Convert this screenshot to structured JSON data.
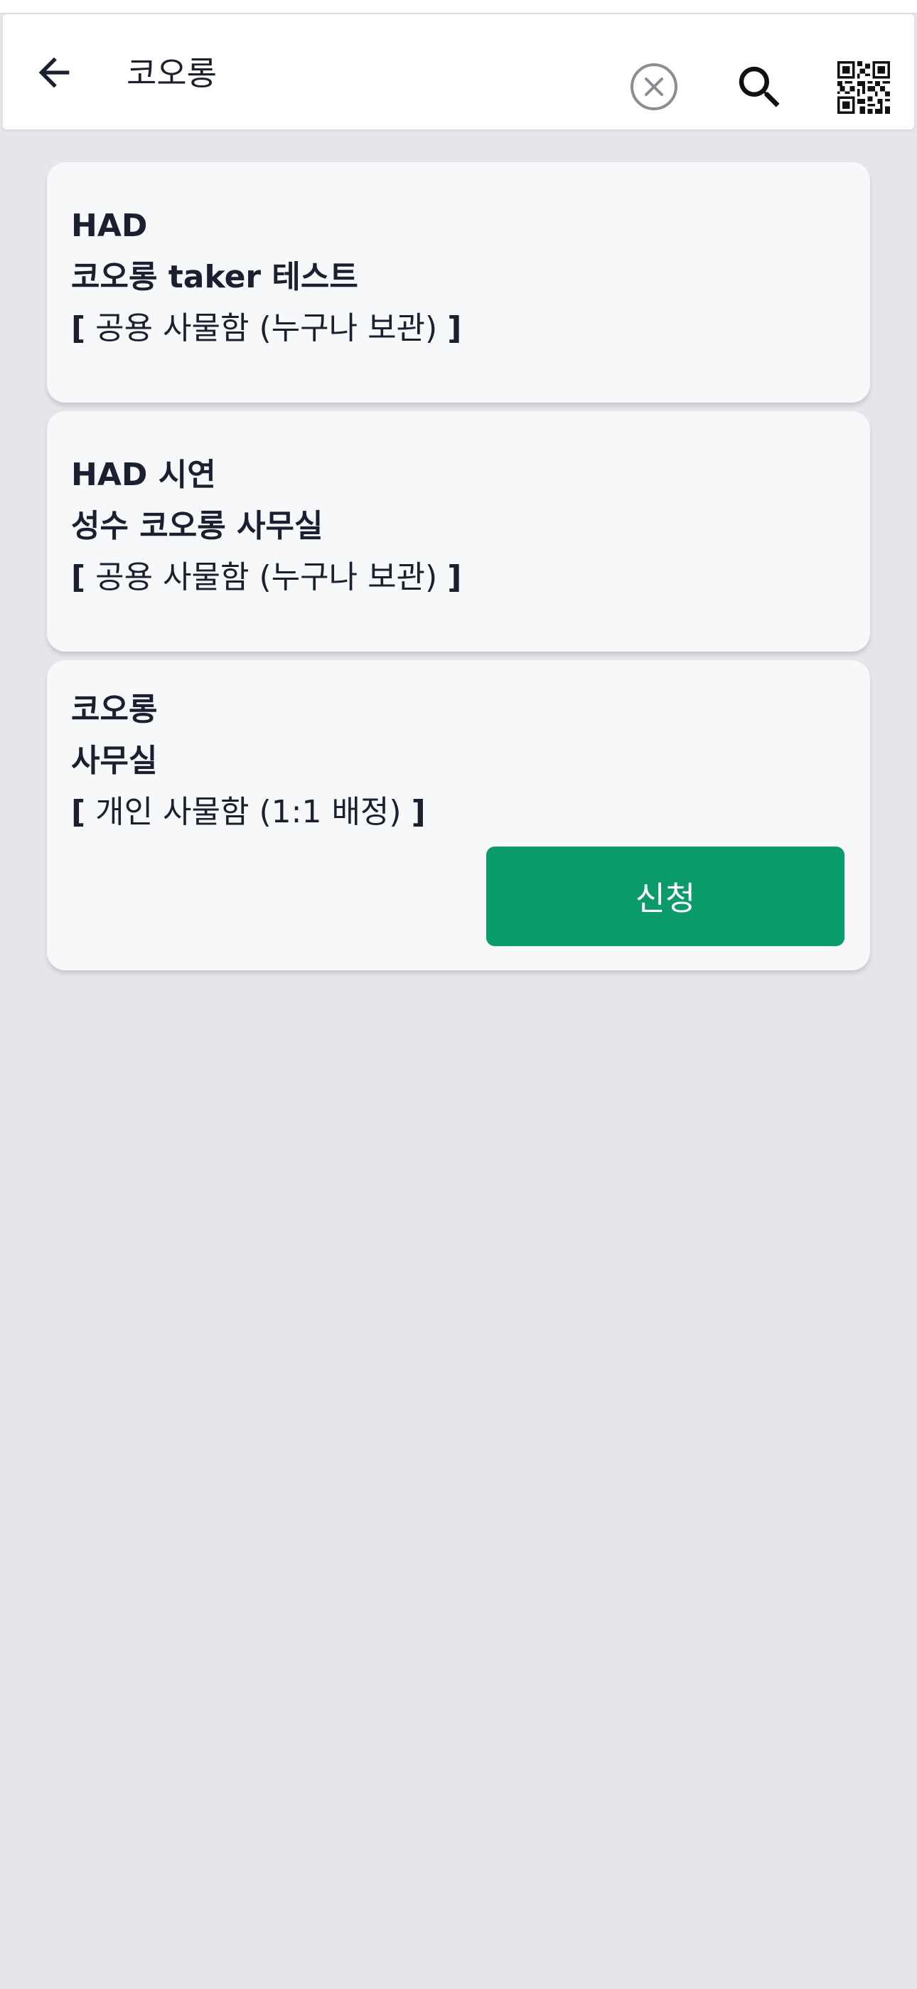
{
  "search": {
    "query": "코오롱"
  },
  "icons": {
    "back": "arrow-left-icon",
    "clear": "clear-circle-icon",
    "search": "search-icon",
    "qr": "qr-code-icon"
  },
  "colors": {
    "background": "#e5e6ea",
    "card": "#f7f8fa",
    "text": "#1b2030",
    "accent": "#0a9a6c"
  },
  "results": [
    {
      "line1": "HAD",
      "line2": "코오롱 taker 테스트",
      "bracket_open": "[",
      "type": "공용 사물함 (누구나 보관)",
      "bracket_close": "]"
    },
    {
      "line1": "HAD 시연",
      "line2": "성수 코오롱 사무실",
      "bracket_open": "[",
      "type": "공용 사물함 (누구나 보관)",
      "bracket_close": "]"
    },
    {
      "line1": "코오롱",
      "line2": "사무실",
      "bracket_open": "[",
      "type": "개인 사물함 (1:1 배정)",
      "bracket_close": "]",
      "action_label": "신청"
    }
  ]
}
